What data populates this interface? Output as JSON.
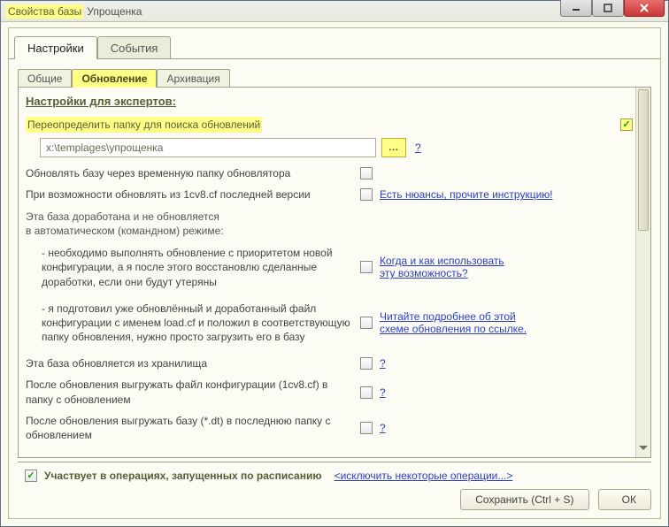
{
  "title_prefix": "Свойства базы",
  "title_name": "Упрощенка",
  "main_tabs": {
    "settings": "Настройки",
    "events": "События"
  },
  "sub_tabs": {
    "general": "Общие",
    "update": "Обновление",
    "archive": "Архивация"
  },
  "header": "Настройки для экспертов:",
  "override_label": "Переопределить папку для поиска обновлений",
  "path_value": "x:\\templages\\упрощенка",
  "browse_label": "...",
  "qmark": "?",
  "rows": {
    "temp_folder": "Обновлять базу через временную папку обновлятора",
    "cv8_label": "При возможности обновлять из 1cv8.cf последней версии",
    "cv8_link": "Есть нюансы, прочите инструкцию!",
    "manual_text": "Эта база доработана и не обновляется\nв автоматическом (командном) режиме:",
    "manual_opt1": "- необходимо выполнять обновление с приоритетом новой конфигурации, а я после этого восстановлю сделанные доработки, если они будут утеряны",
    "manual_opt1_link": "Когда и как использовать\nэту возможность?",
    "manual_opt2": "- я подготовил уже обновлённый и доработанный файл конфигурации с именем load.cf и положил в соответствующую папку обновления, нужно просто загрузить его в базу",
    "manual_opt2_link": "Читайте подробнее об этой\nсхеме обновления по ссылке.",
    "storage": "Эта база обновляется из хранилища",
    "unload_cf": "После обновления выгружать файл конфигурации (1cv8.cf) в папку с обновлением",
    "unload_dt": "После обновления выгружать базу (*.dt) в последнюю папку с обновлением"
  },
  "footer_label": "Участвует в операциях, запущенных по расписанию",
  "footer_link": "<исключить некоторые операции...>",
  "buttons": {
    "save": "Сохранить (Ctrl + S)",
    "ok": "ОК"
  }
}
